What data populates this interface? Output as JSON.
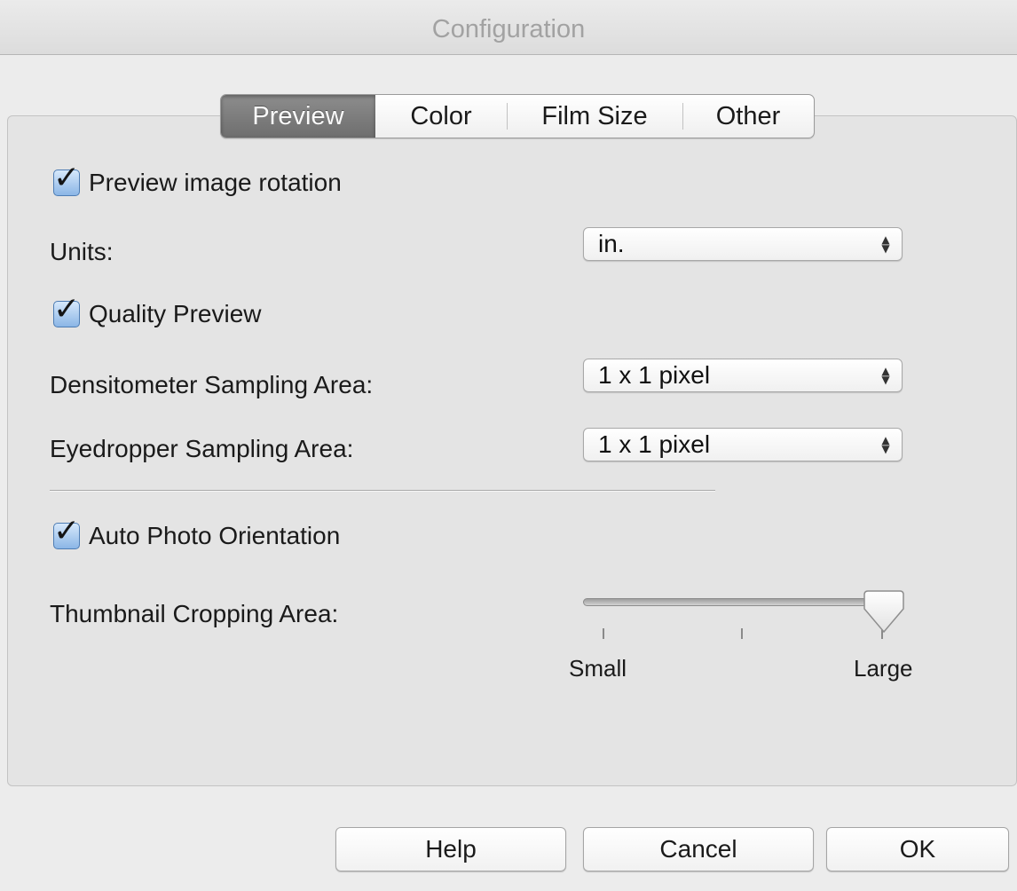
{
  "window": {
    "title": "Configuration"
  },
  "tabs": [
    {
      "label": "Preview",
      "active": true
    },
    {
      "label": "Color",
      "active": false
    },
    {
      "label": "Film Size",
      "active": false
    },
    {
      "label": "Other",
      "active": false
    }
  ],
  "preview": {
    "rotation": {
      "label": "Preview image rotation",
      "checked": true
    },
    "units": {
      "label": "Units:",
      "value": "in."
    },
    "quality": {
      "label": "Quality Preview",
      "checked": true
    },
    "densitometer": {
      "label": "Densitometer Sampling Area:",
      "value": "1 x 1 pixel"
    },
    "eyedropper": {
      "label": "Eyedropper Sampling Area:",
      "value": "1 x 1 pixel"
    },
    "auto_orientation": {
      "label": "Auto Photo Orientation",
      "checked": true
    },
    "thumbnail": {
      "label": "Thumbnail Cropping Area:",
      "min_label": "Small",
      "max_label": "Large",
      "level": 1.0
    }
  },
  "buttons": {
    "help": "Help",
    "cancel": "Cancel",
    "ok": "OK"
  },
  "colors": {
    "accent_check": "#8bb6e6",
    "active_tab": "#7a7a7a"
  }
}
